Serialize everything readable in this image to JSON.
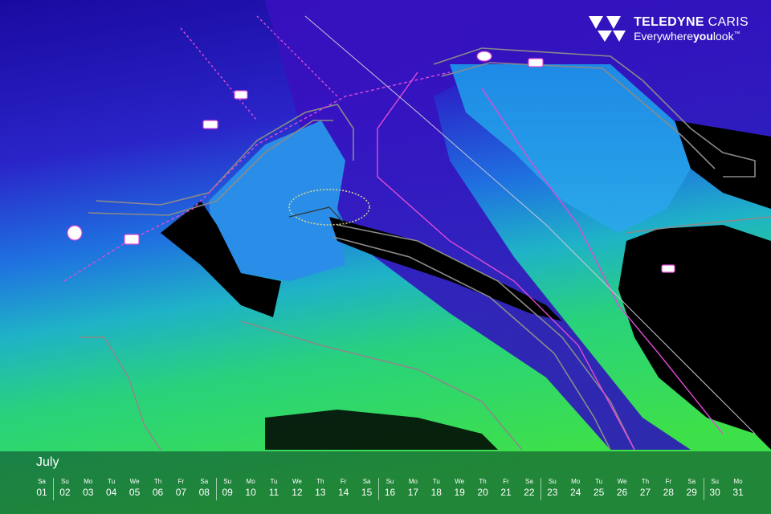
{
  "brand": {
    "name_bold": "TELEDYNE",
    "name_light": "CARIS",
    "tag_start": "Everywhere",
    "tag_bold": "you",
    "tag_end": "look",
    "tag_mark": "™",
    "icon": "teledyne-logo-icon"
  },
  "calendar": {
    "month": "July",
    "days": [
      {
        "name": "Sa",
        "num": "01"
      },
      {
        "name": "Su",
        "num": "02"
      },
      {
        "name": "Mo",
        "num": "03"
      },
      {
        "name": "Tu",
        "num": "04"
      },
      {
        "name": "We",
        "num": "05"
      },
      {
        "name": "Th",
        "num": "06"
      },
      {
        "name": "Fr",
        "num": "07"
      },
      {
        "name": "Sa",
        "num": "08"
      },
      {
        "name": "Su",
        "num": "09"
      },
      {
        "name": "Mo",
        "num": "10"
      },
      {
        "name": "Tu",
        "num": "11"
      },
      {
        "name": "We",
        "num": "12"
      },
      {
        "name": "Th",
        "num": "13"
      },
      {
        "name": "Fr",
        "num": "14"
      },
      {
        "name": "Sa",
        "num": "15"
      },
      {
        "name": "Su",
        "num": "16"
      },
      {
        "name": "Mo",
        "num": "17"
      },
      {
        "name": "Tu",
        "num": "18"
      },
      {
        "name": "We",
        "num": "19"
      },
      {
        "name": "Th",
        "num": "20"
      },
      {
        "name": "Fr",
        "num": "21"
      },
      {
        "name": "Sa",
        "num": "22"
      },
      {
        "name": "Su",
        "num": "23"
      },
      {
        "name": "Mo",
        "num": "24"
      },
      {
        "name": "Tu",
        "num": "25"
      },
      {
        "name": "We",
        "num": "26"
      },
      {
        "name": "Th",
        "num": "27"
      },
      {
        "name": "Fr",
        "num": "28"
      },
      {
        "name": "Sa",
        "num": "29"
      },
      {
        "name": "Su",
        "num": "30"
      },
      {
        "name": "Mo",
        "num": "31"
      }
    ]
  },
  "colors": {
    "deep": "#2a10b8",
    "mid": "#1f7be0",
    "shallow": "#2fd07a",
    "land": "#000000",
    "chart_line": "#8a8a8a",
    "route_line": "#e04bd6"
  }
}
